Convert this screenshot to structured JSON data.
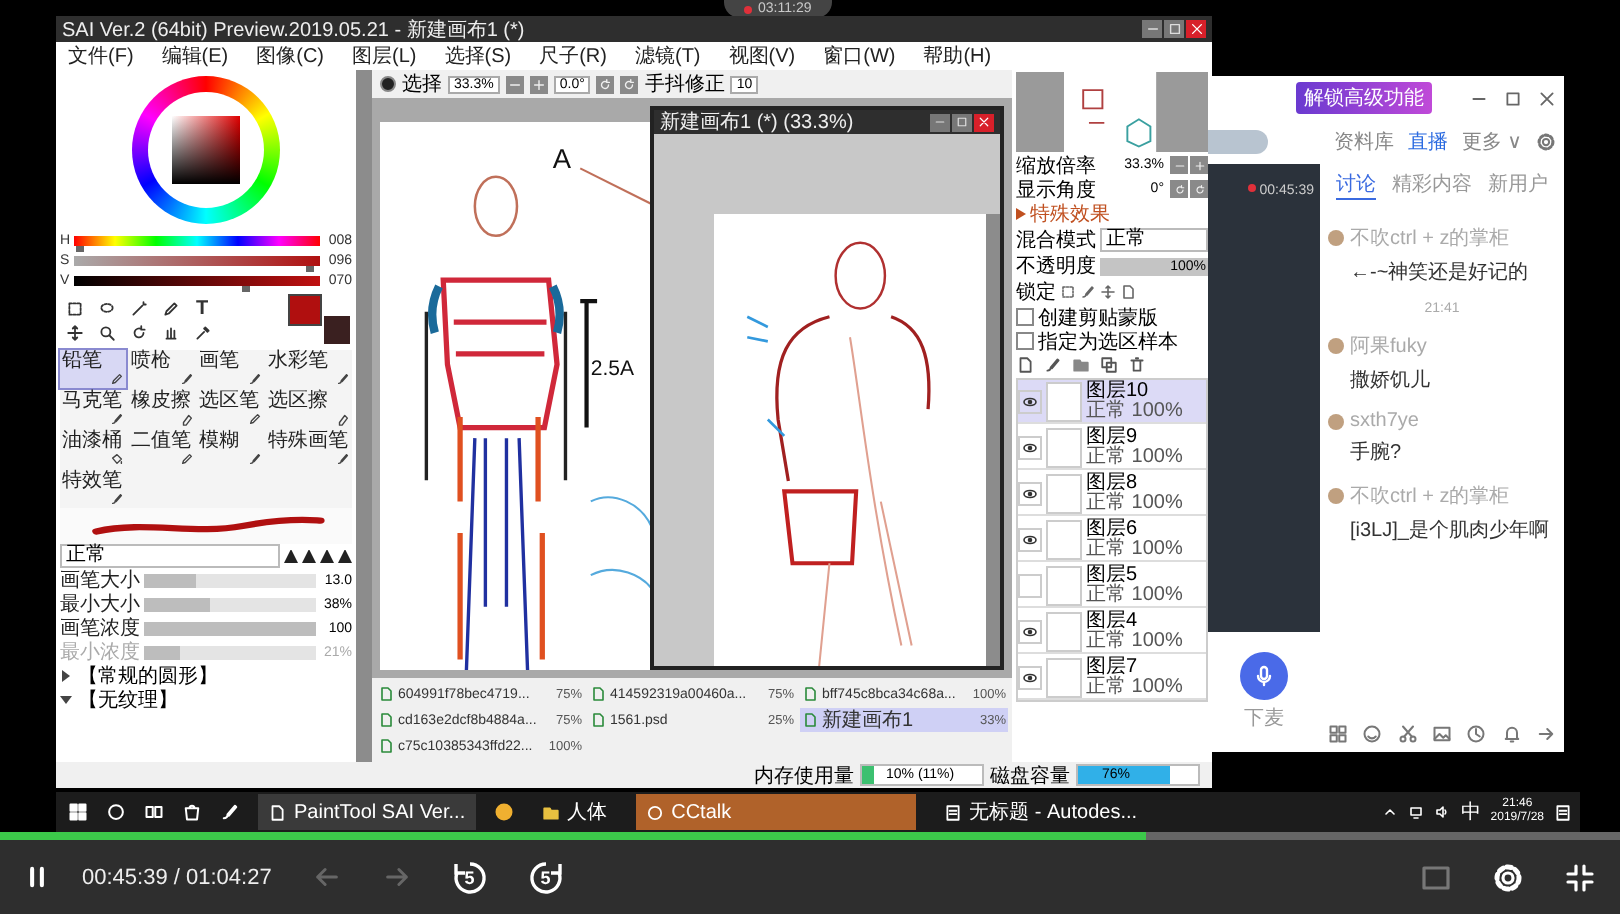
{
  "recording_badge": {
    "time": "03:11:29"
  },
  "sai_window": {
    "title": "SAI Ver.2 (64bit) Preview.2019.05.21 - 新建画布1 (*)",
    "menu": [
      "文件(F)",
      "编辑(E)",
      "图像(C)",
      "图层(L)",
      "选择(S)",
      "尺子(R)",
      "滤镜(T)",
      "视图(V)",
      "窗口(W)",
      "帮助(H)"
    ],
    "color_sliders": [
      {
        "label": "H",
        "value": "008",
        "level": 0.02
      },
      {
        "label": "S",
        "value": "096",
        "level": 0.96
      },
      {
        "label": "V",
        "value": "070",
        "level": 0.7
      }
    ],
    "text_tool_glyph": "T",
    "brushes": [
      {
        "label": "铅笔",
        "selected": true
      },
      {
        "label": "喷枪",
        "selected": false
      },
      {
        "label": "画笔",
        "selected": false
      },
      {
        "label": "水彩笔",
        "selected": false
      },
      {
        "label": "马克笔",
        "selected": false
      },
      {
        "label": "橡皮擦",
        "selected": false
      },
      {
        "label": "选区笔",
        "selected": false
      },
      {
        "label": "选区擦",
        "selected": false
      },
      {
        "label": "油漆桶",
        "selected": false
      },
      {
        "label": "二值笔",
        "selected": false
      },
      {
        "label": "模糊",
        "selected": false
      },
      {
        "label": "特殊画笔",
        "selected": false
      },
      {
        "label": "特效笔",
        "selected": false
      }
    ],
    "blend_mode": "正常",
    "brush_settings": [
      {
        "label": "画笔大小",
        "value": "13.0",
        "level": 0.3,
        "disabled": false
      },
      {
        "label": "最小大小",
        "value": "38%",
        "level": 0.38,
        "disabled": false
      },
      {
        "label": "画笔浓度",
        "value": "100",
        "level": 1,
        "disabled": false
      },
      {
        "label": "最小浓度",
        "value": "21%",
        "level": 0.21,
        "disabled": true
      }
    ],
    "presets": [
      {
        "label": "【常规的圆形】",
        "expanded": false
      },
      {
        "label": "【无纹理】",
        "expanded": true
      }
    ],
    "toolbar": {
      "selection_checked": true,
      "selection_label": "选择",
      "zoom": "33.3%",
      "angle": "0.0°",
      "stabilizer_label": "手抖修正",
      "stabilizer": "10"
    },
    "canvas_notes": [
      "A",
      "2.5A"
    ],
    "subwindow": {
      "title": "新建画布1 (*) (33.3%)"
    },
    "navigator": {
      "zoom_label": "缩放倍率",
      "zoom": "33.3%",
      "angle_label": "显示角度",
      "angle": "0°"
    },
    "layer_props": {
      "section": "特殊效果",
      "blend_label": "混合模式",
      "blend": "正常",
      "opacity": {
        "label": "不透明度",
        "value": "100%",
        "level": 1
      },
      "lock_label": "锁定",
      "options": [
        {
          "label": "创建剪贴蒙版",
          "checked": false
        },
        {
          "label": "指定为选区样本",
          "checked": false
        }
      ]
    },
    "layers": [
      {
        "name": "图层10",
        "mode": "正常",
        "opacity": "100%",
        "visible": true,
        "selected": true
      },
      {
        "name": "图层9",
        "mode": "正常",
        "opacity": "100%",
        "visible": true,
        "selected": false
      },
      {
        "name": "图层8",
        "mode": "正常",
        "opacity": "100%",
        "visible": true,
        "selected": false
      },
      {
        "name": "图层6",
        "mode": "正常",
        "opacity": "100%",
        "visible": true,
        "selected": false
      },
      {
        "name": "图层5",
        "mode": "正常",
        "opacity": "100%",
        "visible": false,
        "selected": false
      },
      {
        "name": "图层4",
        "mode": "正常",
        "opacity": "100%",
        "visible": true,
        "selected": false
      },
      {
        "name": "图层7",
        "mode": "正常",
        "opacity": "100%",
        "visible": true,
        "selected": false
      }
    ],
    "documents": [
      {
        "name": "604991f78bec4719...",
        "zoom": "75%",
        "selected": false
      },
      {
        "name": "414592319a00460a...",
        "zoom": "75%",
        "selected": false
      },
      {
        "name": "bff745c8bca34c68a...",
        "zoom": "100%",
        "selected": false
      },
      {
        "name": "cd163e2dcf8b4884a...",
        "zoom": "75%",
        "selected": false
      },
      {
        "name": "1561.psd",
        "zoom": "25%",
        "selected": false
      },
      {
        "name": "新建画布1",
        "zoom": "33%",
        "selected": true
      },
      {
        "name": "c75c10385343ffd22...",
        "zoom": "100%",
        "selected": false
      }
    ],
    "status": [
      {
        "label": "内存使用量",
        "reading": "10% (11%)",
        "level": 0.1
      },
      {
        "label": "磁盘容量",
        "reading": "76%",
        "level": 0.76
      }
    ]
  },
  "chat_app": {
    "banner": "解锁高级功能",
    "nav": [
      {
        "label": "资料库",
        "selected": false
      },
      {
        "label": "直播",
        "selected": true
      },
      {
        "label": "更多 ∨",
        "selected": false
      }
    ],
    "live_time": "00:45:39",
    "tabs": [
      {
        "label": "讨论",
        "selected": true
      },
      {
        "label": "精彩内容",
        "selected": false
      },
      {
        "label": "新用户",
        "selected": false
      }
    ],
    "messages": [
      {
        "kind": "message",
        "author": "不吹ctrl + z的掌柜",
        "text": "←-~神笑还是好记的"
      },
      {
        "kind": "time",
        "text": "21:41"
      },
      {
        "kind": "message",
        "author": "阿果fuky",
        "text": "撒娇饥儿"
      },
      {
        "kind": "message",
        "author": "sxth7ye",
        "text": "手腕?"
      },
      {
        "kind": "message",
        "author": "不吹ctrl + z的掌柜",
        "text": "[i3LJ]_是个肌肉少年啊"
      }
    ],
    "mic_label": "下麦"
  },
  "taskbar": {
    "apps": [
      {
        "label": "PaintTool SAI Ver...",
        "active": false
      },
      {
        "label": "人体",
        "active": false
      },
      {
        "label": "CCtalk",
        "active": true
      },
      {
        "label": "无标题 - Autodes...",
        "active": false
      }
    ],
    "ime": "中",
    "time": "21:46",
    "date": "2019/7/28"
  },
  "player": {
    "playing": true,
    "level": 0.708,
    "elapsed": "00:45:39",
    "separator": "/",
    "duration": "01:04:27",
    "rewind_label": "5",
    "forward_label": "5"
  }
}
